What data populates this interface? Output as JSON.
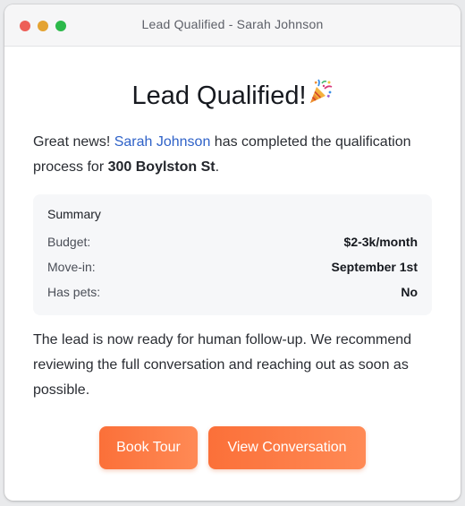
{
  "window": {
    "title": "Lead Qualified - Sarah Johnson"
  },
  "heading": {
    "text": "Lead Qualified!",
    "icon": "party-popper-icon"
  },
  "intro": {
    "prefix": "Great news! ",
    "lead_name": "Sarah Johnson",
    "middle": " has completed the qualification process for ",
    "address": "300 Boylston St",
    "suffix": "."
  },
  "summary": {
    "title": "Summary",
    "rows": [
      {
        "label": "Budget:",
        "value": "$2-3k/month"
      },
      {
        "label": "Move-in:",
        "value": "September 1st"
      },
      {
        "label": "Has pets:",
        "value": "No"
      }
    ]
  },
  "followup": {
    "text": "The lead is now ready for human follow-up. We recommend reviewing the full conversation and reaching out as soon as possible."
  },
  "actions": {
    "book_tour": "Book Tour",
    "view_conversation": "View Conversation"
  },
  "colors": {
    "accent": "#fb7039",
    "link": "#2f62c8",
    "dot_red": "#ed5f57",
    "dot_yellow": "#e4a332",
    "dot_green": "#2cb94a"
  }
}
